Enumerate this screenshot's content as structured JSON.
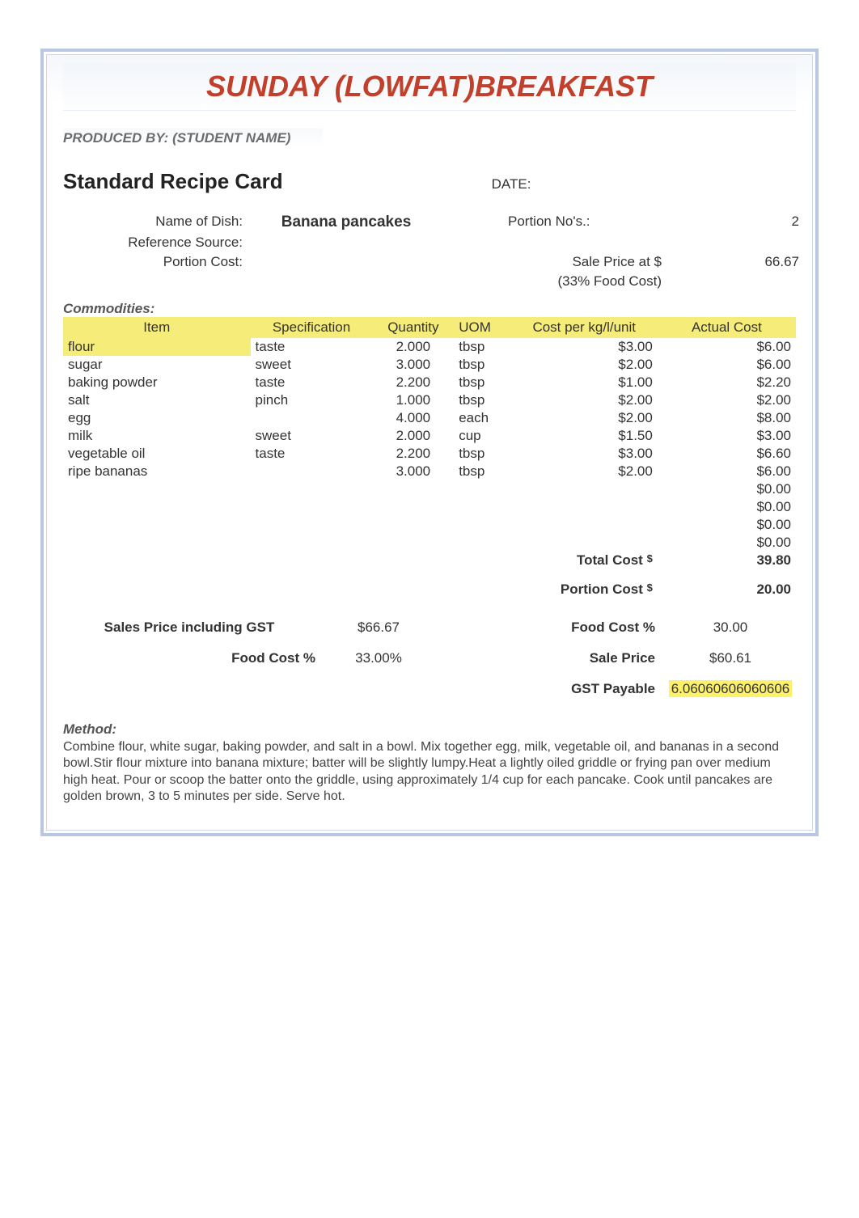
{
  "title": "SUNDAY (LOWFAT)BREAKFAST",
  "produced_by": "PRODUCED BY: (STUDENT NAME)",
  "card_title": "Standard Recipe Card",
  "date_label": "DATE:",
  "labels": {
    "name_of_dish": "Name of Dish:",
    "reference_source": "Reference Source:",
    "portion_cost_top": "Portion Cost:",
    "portion_nos": "Portion No's.:",
    "sale_price_at": "Sale Price at $",
    "food_cost_33": "(33% Food Cost)"
  },
  "dish_name": "Banana pancakes",
  "portion_nos_value": "2",
  "sale_price_at_value": "66.67",
  "commodities_heading": "Commodities:",
  "columns": {
    "item": "Item",
    "spec": "Specification",
    "qty": "Quantity",
    "uom": "UOM",
    "cpu": "Cost per kg/l/unit",
    "actual": "Actual Cost"
  },
  "rows": [
    {
      "item": "flour",
      "spec": "taste",
      "qty": "2.000",
      "uom": "tbsp",
      "cpu": "$3.00",
      "act": "$6.00"
    },
    {
      "item": "sugar",
      "spec": "sweet",
      "qty": "3.000",
      "uom": "tbsp",
      "cpu": "$2.00",
      "act": "$6.00"
    },
    {
      "item": "baking powder",
      "spec": "taste",
      "qty": "2.200",
      "uom": "tbsp",
      "cpu": "$1.00",
      "act": "$2.20"
    },
    {
      "item": "salt",
      "spec": "pinch",
      "qty": "1.000",
      "uom": "tbsp",
      "cpu": "$2.00",
      "act": "$2.00"
    },
    {
      "item": "egg",
      "spec": "",
      "qty": "4.000",
      "uom": "each",
      "cpu": "$2.00",
      "act": "$8.00"
    },
    {
      "item": "milk",
      "spec": "sweet",
      "qty": "2.000",
      "uom": "cup",
      "cpu": "$1.50",
      "act": "$3.00"
    },
    {
      "item": "vegetable oil",
      "spec": "taste",
      "qty": "2.200",
      "uom": "tbsp",
      "cpu": "$3.00",
      "act": "$6.60"
    },
    {
      "item": "ripe bananas",
      "spec": "",
      "qty": "3.000",
      "uom": "tbsp",
      "cpu": "$2.00",
      "act": "$6.00"
    },
    {
      "item": "",
      "spec": "",
      "qty": "",
      "uom": "",
      "cpu": "",
      "act": "$0.00"
    },
    {
      "item": "",
      "spec": "",
      "qty": "",
      "uom": "",
      "cpu": "",
      "act": "$0.00"
    },
    {
      "item": "",
      "spec": "",
      "qty": "",
      "uom": "",
      "cpu": "",
      "act": "$0.00"
    },
    {
      "item": "",
      "spec": "",
      "qty": "",
      "uom": "",
      "cpu": "",
      "act": "$0.00"
    }
  ],
  "totals": {
    "total_cost_label": "Total Cost",
    "total_cost_value": "39.80",
    "portion_cost_label": "Portion Cost",
    "portion_cost_value": "20.00"
  },
  "summary": {
    "sales_price_gst_label": "Sales Price including GST",
    "sales_price_gst_value": "$66.67",
    "food_cost_pct_label_left": "Food Cost %",
    "food_cost_pct_value_left": "33.00%",
    "food_cost_pct_label_right": "Food Cost %",
    "food_cost_pct_value_right": "30.00",
    "sale_price_label": "Sale Price",
    "sale_price_value": "$60.61",
    "gst_payable_label": "GST Payable",
    "gst_payable_value": "6.06060606060606"
  },
  "method_label": "Method:",
  "method_text": "Combine flour, white sugar, baking powder, and salt in a bowl. Mix together egg, milk, vegetable oil, and bananas in a second bowl.Stir flour mixture into banana mixture; batter will be slightly lumpy.Heat a lightly oiled griddle or frying pan over medium high heat. Pour or scoop the batter onto the griddle, using approximately 1/4 cup for each pancake. Cook until pancakes are golden brown, 3 to 5 minutes per side. Serve hot."
}
